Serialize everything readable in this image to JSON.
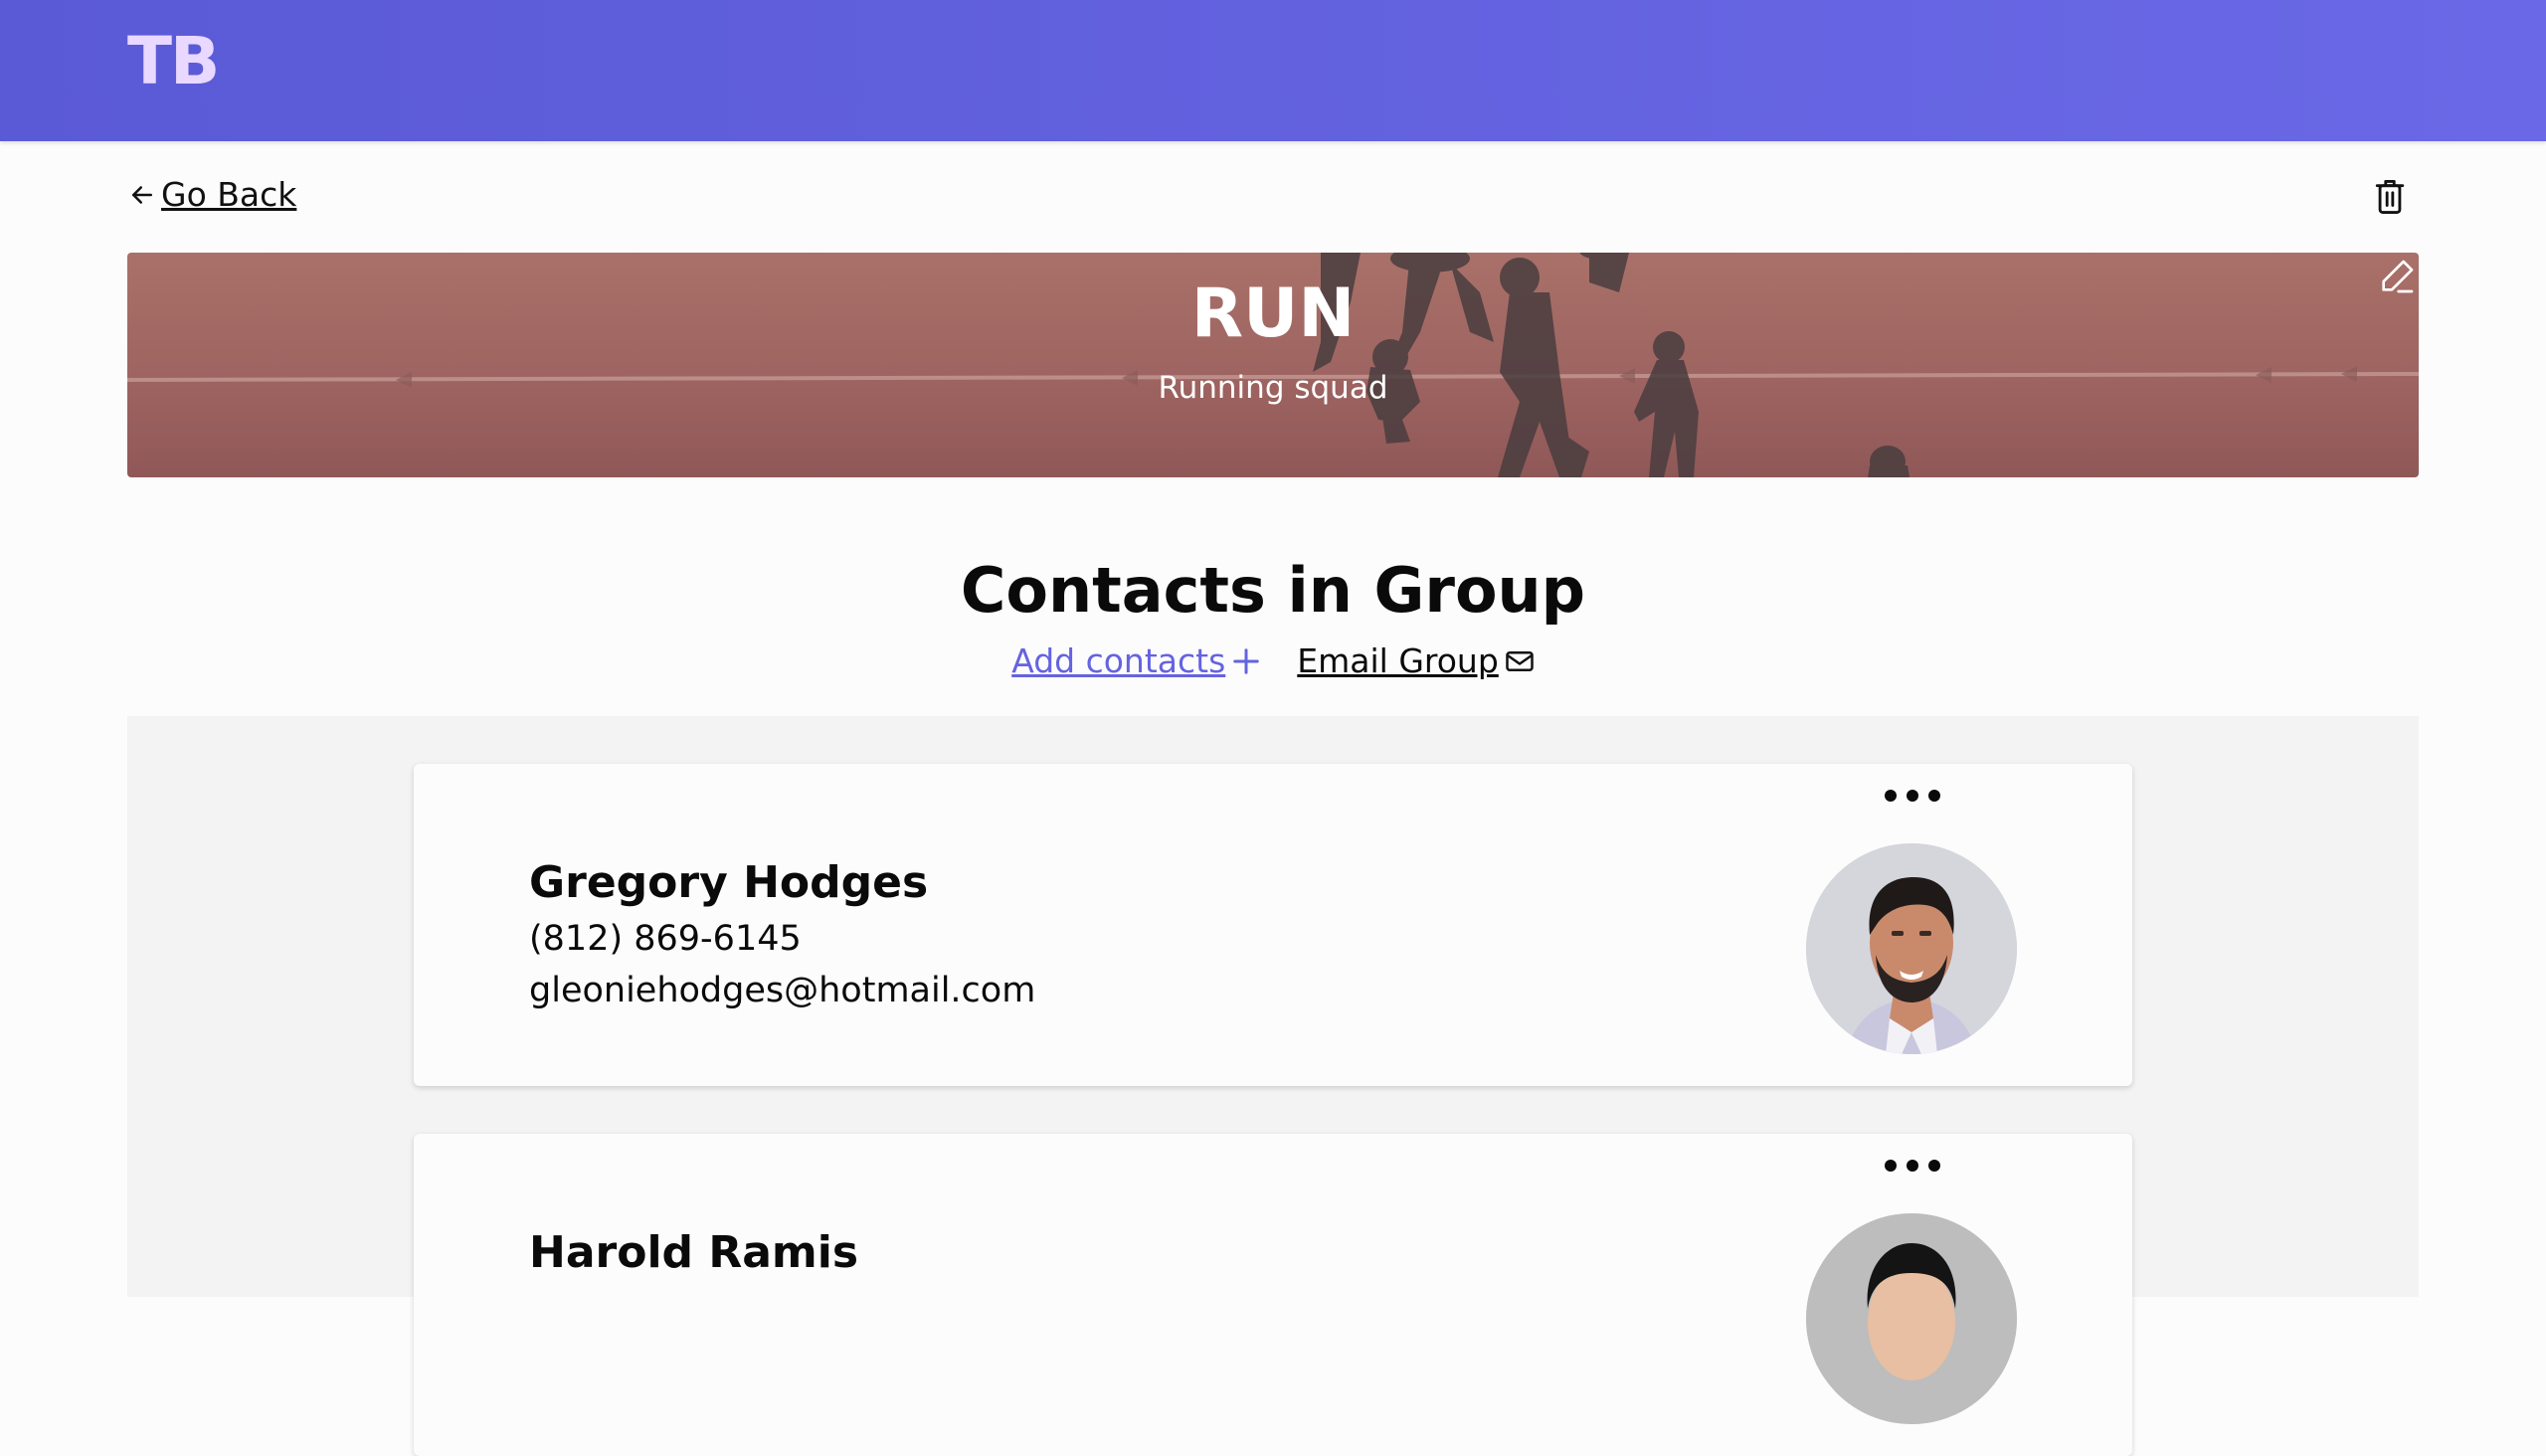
{
  "app": {
    "logo": "TB"
  },
  "nav": {
    "back_label": "Go Back"
  },
  "group": {
    "title": "RUN",
    "subtitle": "Running squad"
  },
  "contacts_section": {
    "heading": "Contacts in Group",
    "add_label": "Add contacts",
    "email_label": "Email Group"
  },
  "contacts": [
    {
      "name": "Gregory Hodges",
      "phone": "(812) 869-6145",
      "email": "gleoniehodges@hotmail.com"
    },
    {
      "name": "Harold Ramis",
      "phone": "",
      "email": ""
    }
  ],
  "icons": {
    "back": "arrow-left-icon",
    "delete": "trash-icon",
    "edit": "pencil-icon",
    "add": "plus-icon",
    "email": "mail-icon",
    "more": "more-horizontal-icon"
  },
  "colors": {
    "header": "#5b5ad6",
    "accent": "#6563e0",
    "logo": "#e9d8ff",
    "banner": "#a97169"
  }
}
